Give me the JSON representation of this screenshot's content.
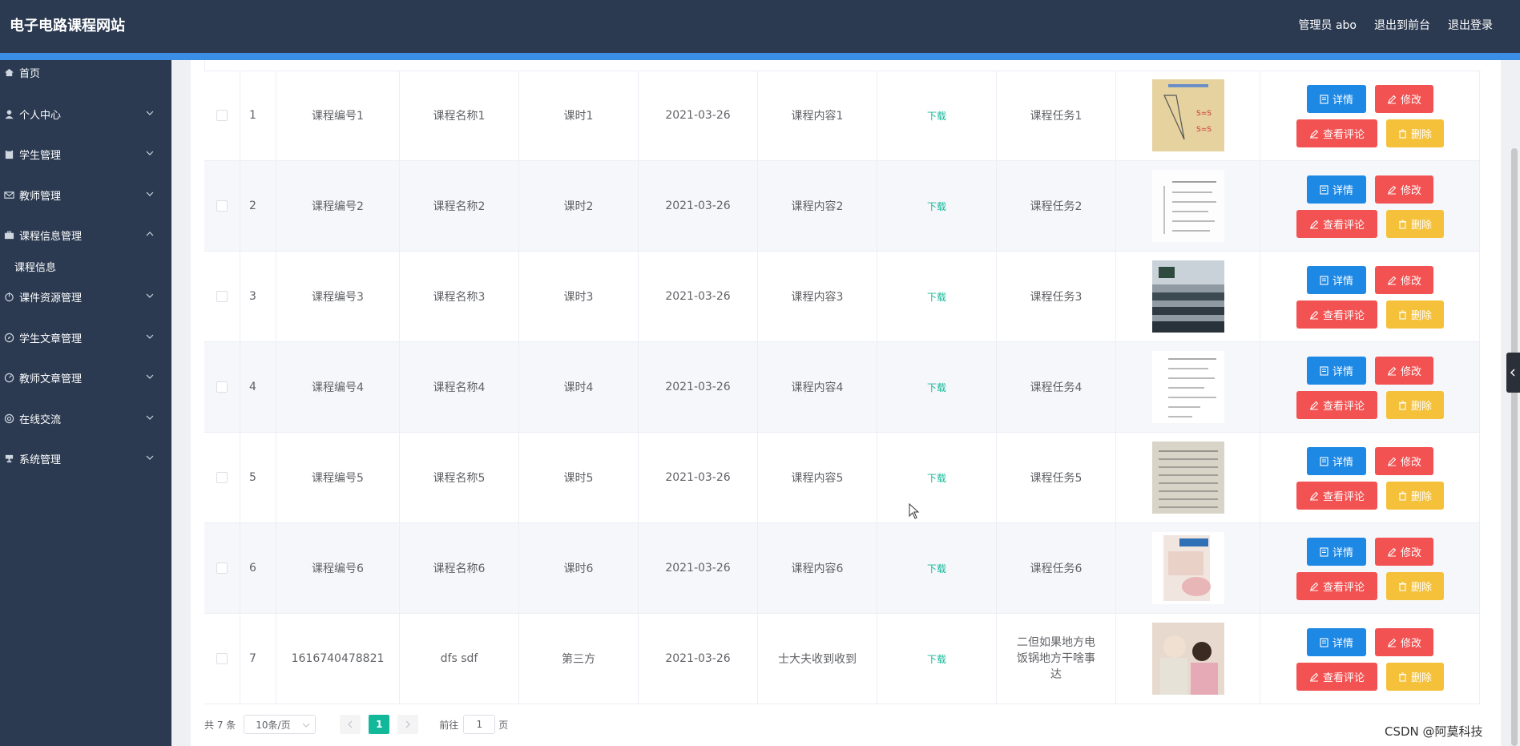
{
  "header": {
    "title": "电子电路课程网站",
    "user": "管理员 abo",
    "to_front": "退出到前台",
    "logout": "退出登录"
  },
  "sidebar": {
    "items": [
      {
        "label": "首页",
        "icon": "home-icon",
        "expanded": false,
        "has_arrow": false
      },
      {
        "label": "个人中心",
        "icon": "user-icon",
        "has_arrow": true,
        "expanded": false
      },
      {
        "label": "学生管理",
        "icon": "clipboard-icon",
        "has_arrow": true,
        "expanded": false
      },
      {
        "label": "教师管理",
        "icon": "mail-icon",
        "has_arrow": true,
        "expanded": false
      },
      {
        "label": "课程信息管理",
        "icon": "briefcase-icon",
        "has_arrow": true,
        "expanded": true,
        "children": [
          "课程信息"
        ]
      },
      {
        "label": "课件资源管理",
        "icon": "power-icon",
        "has_arrow": true,
        "expanded": false
      },
      {
        "label": "学生文章管理",
        "icon": "compass-icon",
        "has_arrow": true,
        "expanded": false
      },
      {
        "label": "教师文章管理",
        "icon": "dashboard-icon",
        "has_arrow": true,
        "expanded": false
      },
      {
        "label": "在线交流",
        "icon": "support-icon",
        "has_arrow": true,
        "expanded": false
      },
      {
        "label": "系统管理",
        "icon": "trophy-icon",
        "has_arrow": true,
        "expanded": false
      }
    ]
  },
  "table": {
    "rows": [
      {
        "idx": "1",
        "code": "课程编号1",
        "name": "课程名称1",
        "hours": "课时1",
        "date": "2021-03-26",
        "content": "课程内容1",
        "download": "下载",
        "task": "课程任务1",
        "thumb": "thumb-1"
      },
      {
        "idx": "2",
        "code": "课程编号2",
        "name": "课程名称2",
        "hours": "课时2",
        "date": "2021-03-26",
        "content": "课程内容2",
        "download": "下载",
        "task": "课程任务2",
        "thumb": "thumb-2"
      },
      {
        "idx": "3",
        "code": "课程编号3",
        "name": "课程名称3",
        "hours": "课时3",
        "date": "2021-03-26",
        "content": "课程内容3",
        "download": "下载",
        "task": "课程任务3",
        "thumb": "thumb-3"
      },
      {
        "idx": "4",
        "code": "课程编号4",
        "name": "课程名称4",
        "hours": "课时4",
        "date": "2021-03-26",
        "content": "课程内容4",
        "download": "下载",
        "task": "课程任务4",
        "thumb": "thumb-4"
      },
      {
        "idx": "5",
        "code": "课程编号5",
        "name": "课程名称5",
        "hours": "课时5",
        "date": "2021-03-26",
        "content": "课程内容5",
        "download": "下载",
        "task": "课程任务5",
        "thumb": "thumb-5"
      },
      {
        "idx": "6",
        "code": "课程编号6",
        "name": "课程名称6",
        "hours": "课时6",
        "date": "2021-03-26",
        "content": "课程内容6",
        "download": "下载",
        "task": "课程任务6",
        "thumb": "thumb-6"
      },
      {
        "idx": "7",
        "code": "1616740478821",
        "name": "dfs sdf",
        "hours": "第三方",
        "date": "2021-03-26",
        "content": "士大夫收到收到",
        "download": "下载",
        "task": "二但如果地方电饭锅地方干啥事达",
        "thumb": "thumb-7"
      }
    ],
    "actions": {
      "detail": "详情",
      "edit": "修改",
      "comments": "查看评论",
      "delete": "删除"
    }
  },
  "pager": {
    "total": "共 7 条",
    "page_size": "10条/页",
    "current": "1",
    "goto_prefix": "前往",
    "goto_value": "1",
    "goto_suffix": "页"
  },
  "watermark": "CSDN @阿莫科技",
  "colors": {
    "header": "#2b3a51",
    "accent": "#3a8ee6",
    "primary": "#1e88e5",
    "danger": "#f25252",
    "warning": "#f5c13a",
    "success": "#13b89a"
  }
}
